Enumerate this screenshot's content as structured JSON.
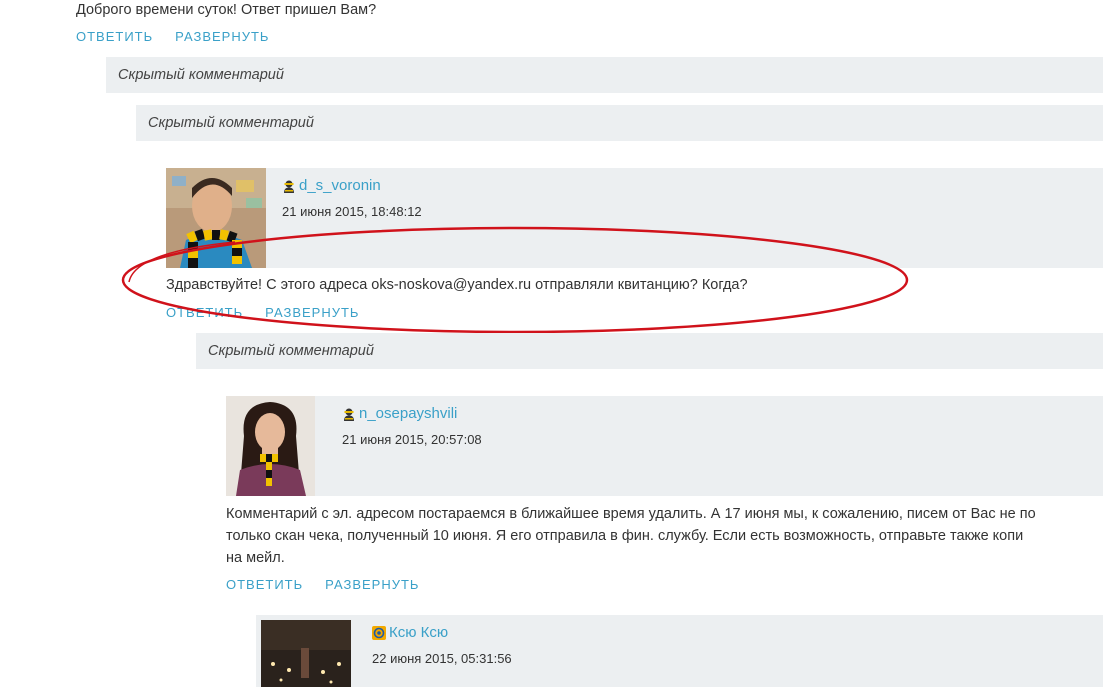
{
  "top_comment": {
    "text": "Доброго времени суток! Ответ пришел Вам?",
    "reply_label": "ОТВЕТИТЬ",
    "expand_label": "РАЗВЕРНУТЬ"
  },
  "hidden_comments": {
    "first": "Скрытый комментарий",
    "second": "Скрытый комментарий",
    "third": "Скрытый комментарий"
  },
  "comment_1": {
    "author": "d_s_voronin",
    "author_icon": "moderator-icon",
    "date": "21 июня 2015, 18:48:12",
    "text": "Здравствуйте! С этого адреса oks-noskova@yandex.ru отправляли квитанцию? Когда?",
    "reply_label": "ОТВЕТИТЬ",
    "expand_label": "РАЗВЕРНУТЬ"
  },
  "comment_2": {
    "author": "n_osepayshvili",
    "author_icon": "moderator-icon",
    "date": "21 июня 2015, 20:57:08",
    "text_lines": [
      "Комментарий с эл. адресом постараемся в ближайшее время удалить. А 17 июня мы, к сожалению, писем от Вас не по",
      "только скан чека, полученный 10 июня. Я его отправила в фин. службу. Если есть возможность, отправьте также копи",
      "на мейл."
    ],
    "reply_label": "ОТВЕТИТЬ",
    "expand_label": "РАЗВЕРНУТЬ"
  },
  "comment_3": {
    "author": "Ксю Ксю",
    "author_icon": "mailru-icon",
    "date": "22 июня 2015, 05:31:56"
  },
  "colors": {
    "link": "#3aa0c8",
    "panel": "#eceff1",
    "highlight_ellipse": "#d0121b"
  }
}
